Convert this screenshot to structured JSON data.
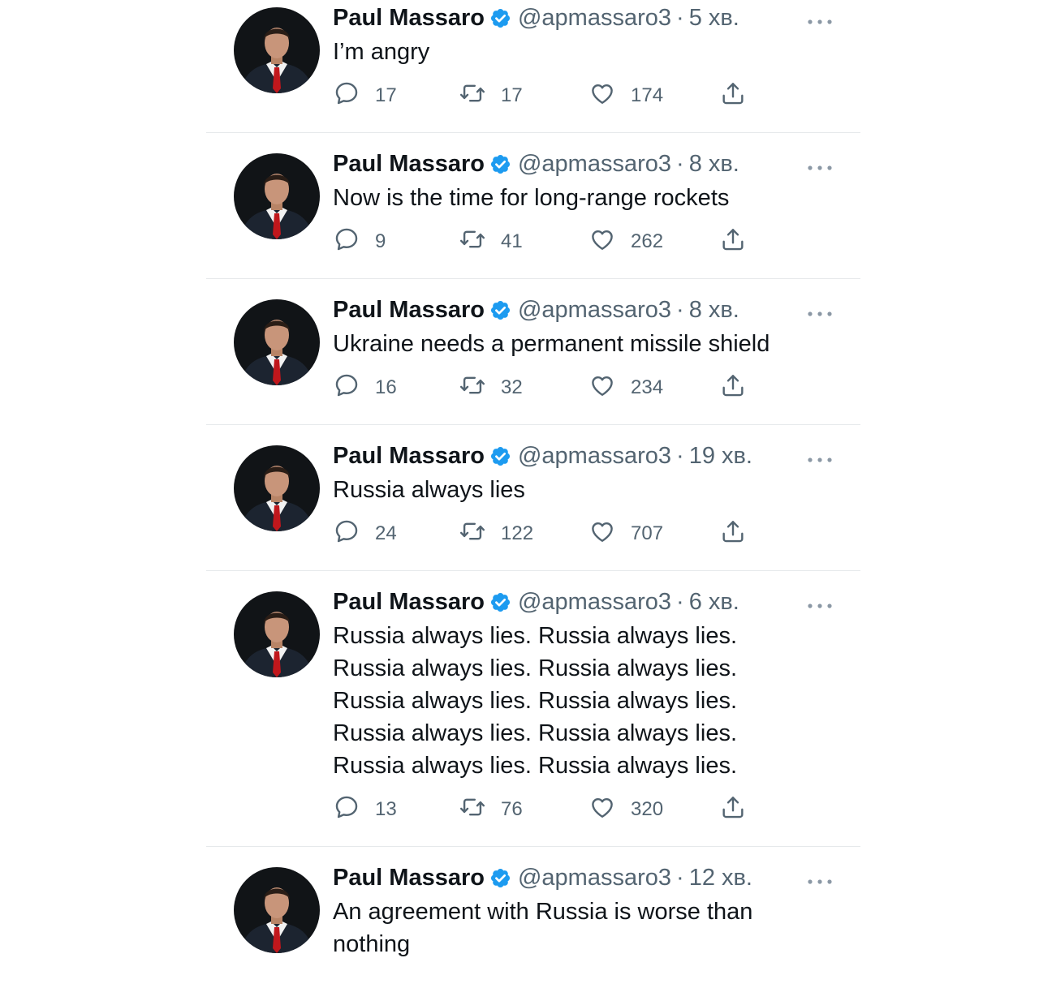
{
  "accent_color": "#1d9bf0",
  "text_color": "#0f1419",
  "secondary_color": "#536471",
  "divider_color": "#e6e9eb",
  "tweets": [
    {
      "display_name": "Paul Massaro",
      "handle": "@apmassaro3",
      "separator": "·",
      "time": "5 хв.",
      "text_lines": [
        "I’m angry"
      ],
      "replies": "17",
      "retweets": "17",
      "likes": "174"
    },
    {
      "display_name": "Paul Massaro",
      "handle": "@apmassaro3",
      "separator": "·",
      "time": "8 хв.",
      "text_lines": [
        "Now is the time for long-range rockets"
      ],
      "replies": "9",
      "retweets": "41",
      "likes": "262"
    },
    {
      "display_name": "Paul Massaro",
      "handle": "@apmassaro3",
      "separator": "·",
      "time": "8 хв.",
      "text_lines": [
        "Ukraine needs a permanent missile shield"
      ],
      "replies": "16",
      "retweets": "32",
      "likes": "234"
    },
    {
      "display_name": "Paul Massaro",
      "handle": "@apmassaro3",
      "separator": "·",
      "time": "19 хв.",
      "text_lines": [
        "Russia always lies"
      ],
      "replies": "24",
      "retweets": "122",
      "likes": "707"
    },
    {
      "display_name": "Paul Massaro",
      "handle": "@apmassaro3",
      "separator": "·",
      "time": "6 хв.",
      "text_lines": [
        "Russia always lies. Russia always lies.",
        "Russia always lies. Russia always lies.",
        "Russia always lies. Russia always lies.",
        "Russia always lies. Russia always lies.",
        "Russia always lies. Russia always lies."
      ],
      "replies": "13",
      "retweets": "76",
      "likes": "320"
    },
    {
      "display_name": "Paul Massaro",
      "handle": "@apmassaro3",
      "separator": "·",
      "time": "12 хв.",
      "text_lines": [
        "An agreement with Russia is worse than",
        "nothing"
      ]
    }
  ]
}
